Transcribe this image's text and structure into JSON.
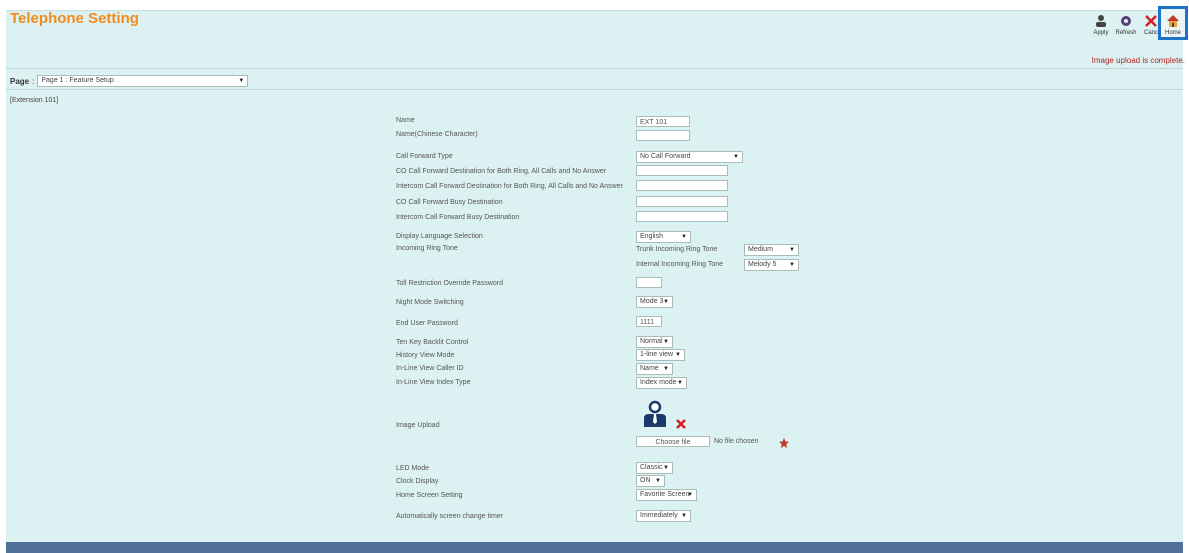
{
  "header": {
    "title": "Telephone Setting",
    "status_message": "Image upload is complete."
  },
  "toolbar": {
    "apply_label": "Apply",
    "refresh_label": "Refresh",
    "cancel_label": "Canc",
    "home_label": "Home"
  },
  "page_select": {
    "label": "Page",
    "value": "Page 1 : Feature Setup"
  },
  "section_label": "[Extension 101]",
  "form": {
    "name_label": "Name",
    "name_value": "EXT 101",
    "name_chinese_label": "Name(Chinese Character)",
    "name_chinese_value": "",
    "call_forward_type_label": "Call Forward Type",
    "call_forward_type_value": "No Call Forward",
    "co_cf_dest_label": "CO Call Forward Destination for Both Ring, All Calls and No Answer",
    "intercom_cf_dest_label": "Intercom Call Forward Destination for Both Ring, All Calls and No Answer",
    "co_cf_busy_label": "CO Call Forward Busy Destination",
    "intercom_cf_busy_label": "Intercom Call Forward Busy Destination",
    "display_language_label": "Display Language Selection",
    "display_language_value": "English",
    "incoming_ring_tone_label": "Incoming Ring Tone",
    "trunk_ring_tone_label": "Trunk Incoming Ring Tone",
    "trunk_ring_tone_value": "Medium",
    "internal_ring_tone_label": "Internal Incoming Ring Tone",
    "internal_ring_tone_value": "Melody 5",
    "toll_restriction_label": "Toll Restriction Override Password",
    "toll_restriction_value": "",
    "night_mode_label": "Night Mode Switching",
    "night_mode_value": "Mode 3",
    "end_user_password_label": "End User Password",
    "end_user_password_value": "1111",
    "ten_key_backlit_label": "Ten Key Backlit Control",
    "ten_key_backlit_value": "Normal",
    "history_view_mode_label": "History View Mode",
    "history_view_mode_value": "1-line view",
    "in_line_caller_id_label": "In-Line View Caller ID",
    "in_line_caller_id_value": "Name",
    "in_line_index_type_label": "In-Line View Index Type",
    "in_line_index_type_value": "Index mode",
    "image_upload_label": "Image Upload",
    "led_mode_label": "LED Mode",
    "led_mode_value": "Classic",
    "clock_display_label": "Clock Display",
    "clock_display_value": "ON",
    "home_screen_label": "Home Screen Setting",
    "home_screen_value": "Favorite Screen",
    "auto_screen_change_label": "Automatically screen change timer",
    "auto_screen_change_value": "Immediately"
  },
  "upload": {
    "choose_button_label": "Choose file",
    "file_name": "No file chosen"
  },
  "colors": {
    "title": "#f28c1c",
    "panel_bg": "#dcf1f1",
    "footer": "#4f6e99",
    "highlight_border": "#1e73c8",
    "status_text": "#b22222"
  }
}
